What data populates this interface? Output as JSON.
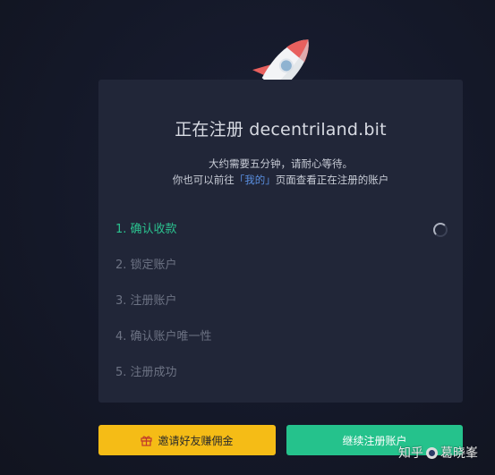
{
  "dialog": {
    "title": "正在注册 decentriland.bit",
    "subtitle_line1": "大约需要五分钟，请耐心等待。",
    "subtitle_line2_prefix": "你也可以前往",
    "subtitle_link": "「我的」",
    "subtitle_line2_suffix": "页面查看正在注册的账户"
  },
  "steps": [
    {
      "label": "1. 确认收款",
      "status": "active"
    },
    {
      "label": "2. 锁定账户",
      "status": "pending"
    },
    {
      "label": "3. 注册账户",
      "status": "pending"
    },
    {
      "label": "4. 确认账户唯一性",
      "status": "pending"
    },
    {
      "label": "5. 注册成功",
      "status": "pending"
    }
  ],
  "buttons": {
    "invite_label": "邀请好友赚佣金",
    "continue_label": "继续注册账户"
  },
  "watermark": {
    "text_left": "知乎",
    "text_right": "葛晓峯"
  },
  "icons": {
    "rocket": "rocket-icon",
    "loading": "spinner-icon",
    "gift": "gift-icon"
  },
  "colors": {
    "background": "#14182a",
    "card": "#212638",
    "active_step": "#2bc28f",
    "pending_step": "#6d7384",
    "link": "#5a8fe0",
    "invite_button": "#f5bc16",
    "continue_button": "#25c28c"
  }
}
